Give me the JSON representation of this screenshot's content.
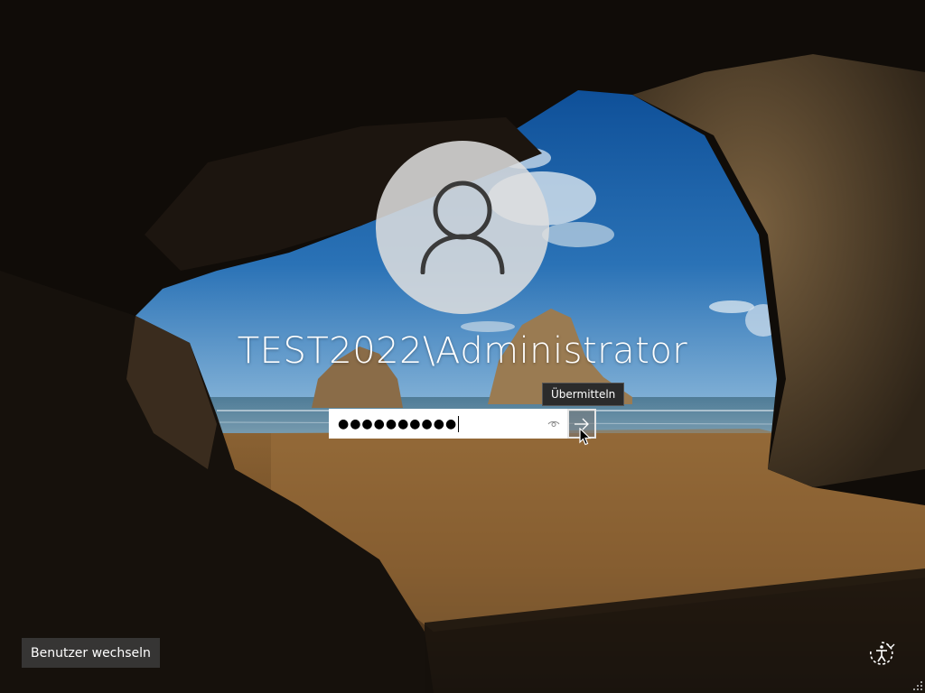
{
  "login": {
    "username": "TEST2022\\Administrator",
    "password_mask": "●●●●●●●●●●",
    "tooltip": "Übermitteln"
  },
  "footer": {
    "switch_user_label": "Benutzer wechseln"
  },
  "icons": {
    "avatar": "user-silhouette-icon",
    "reveal": "eye-icon",
    "submit": "arrow-right-icon",
    "accessibility": "ease-of-access-icon",
    "cursor": "mouse-pointer-icon"
  },
  "colors": {
    "text": "#ffffff",
    "field_bg": "#ffffff",
    "tooltip_bg": "#2b2b2b",
    "button_bg": "#3c3c3c"
  }
}
